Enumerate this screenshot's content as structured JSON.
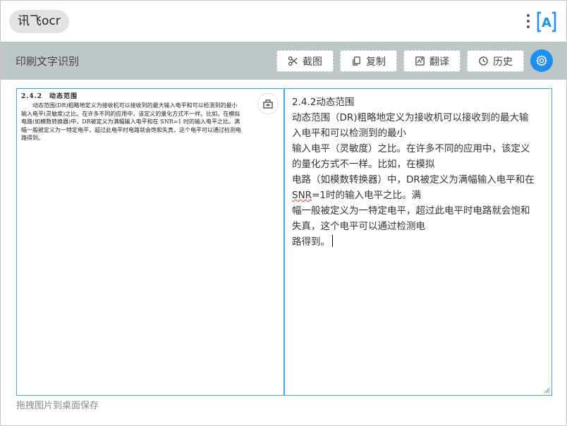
{
  "app": {
    "title": "讯飞ocr",
    "logo_letter": "A"
  },
  "toolbar": {
    "title": "印刷文字识别",
    "buttons": [
      {
        "label": "截图",
        "icon": "scissors-icon"
      },
      {
        "label": "复制",
        "icon": "copy-icon"
      },
      {
        "label": "翻译",
        "icon": "translate-icon"
      },
      {
        "label": "历史",
        "icon": "history-icon"
      }
    ],
    "settings_icon": "gear-icon"
  },
  "source_image": {
    "heading": "2.4.2　动态范围",
    "lines": [
      "动态范围(DR)粗略地定义为接收机可以接收到的最大输入电平和可以检测到的最小",
      "输入电平(灵敏度)之比。在许多不同的应用中，该定义的量化方式不一样。比如，在模拟",
      "电路(如模数转换器)中，DR被定义为满幅输入电平和在 SNR=1 时的输入电平之比。满",
      "幅一般被定义为一特定电平，超过此电平时电路就会饱和失真，这个电平可以通过检测电",
      "路得到。"
    ]
  },
  "result": {
    "lines": [
      "2.4.2动态范围",
      "动态范围（DR)粗略地定义为接收机可以接收到的最大输",
      "入电平和可以检测到的最小",
      "输入电平（灵敏度）之比。在许多不同的应用中，该定义",
      "的量化方式不一样。比如，在模拟",
      "电路（如模数转换器）中，DR被定义为满幅输入电平和在",
      "SNR=1时的输入电平之比。满",
      "幅一般被定义为一特定电平，超过此电平时电路就会饱和",
      "失真，这个电平可以通过检测电",
      "路得到。"
    ],
    "spellcheck_word": "SNR",
    "line7_rest": "=1时的输入电平之比。满"
  },
  "footer": {
    "hint": "拖拽图片到桌面保存"
  },
  "colors": {
    "accent": "#1e8ef0",
    "toolbar_bg": "#bec6c8",
    "panel_border": "#4aa3e6"
  }
}
